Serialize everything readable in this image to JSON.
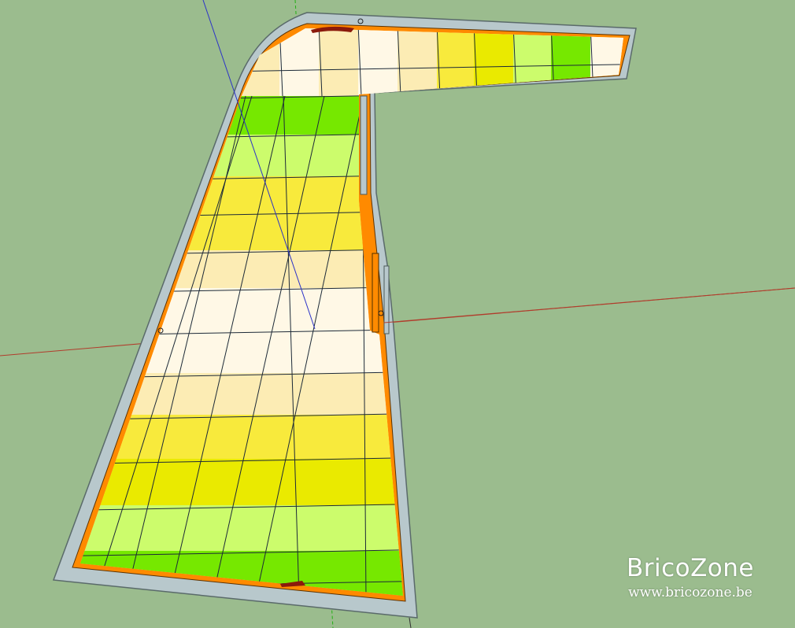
{
  "viewport": {
    "background_color": "#9bbc8e",
    "axis_colors": {
      "red": "#b13c2c",
      "green": "#22b014",
      "blue": "#2b32c8"
    }
  },
  "model": {
    "outer_border_color": "#b8c8cc",
    "edge_color": "#ff8a00",
    "tile_colors": [
      "#fff8e6",
      "#fcecb4",
      "#f8ea3c",
      "#eaea00",
      "#ccfc6c",
      "#76e800"
    ]
  },
  "watermark": {
    "brand": "BricoZone",
    "url": "www.bricozone.be"
  }
}
